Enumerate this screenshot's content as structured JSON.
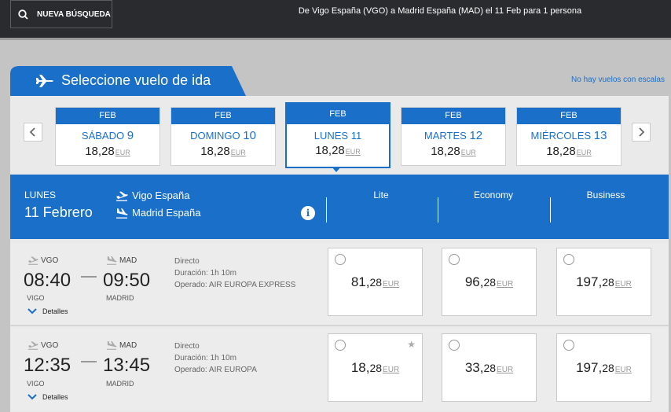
{
  "topbar": {
    "new_search": "NUEVA BÚSQUEDA",
    "route": "De Vigo España (VGO) a Madrid España (MAD) el 11 Feb para 1 persona"
  },
  "title": "Seleccione vuelo de ida",
  "no_connections": "No hay vuelos con escalas",
  "currency": "EUR",
  "days": [
    {
      "month": "FEB",
      "day": "SÁBADO",
      "num": "9",
      "int": "18,",
      "dec": "28"
    },
    {
      "month": "FEB",
      "day": "DOMINGO",
      "num": "10",
      "int": "18,",
      "dec": "28"
    },
    {
      "month": "FEB",
      "day": "LUNES",
      "num": "11",
      "int": "18,",
      "dec": "28"
    },
    {
      "month": "FEB",
      "day": "MARTES",
      "num": "12",
      "int": "18,",
      "dec": "28"
    },
    {
      "month": "FEB",
      "day": "MIÉRCOLES",
      "num": "13",
      "int": "18,",
      "dec": "28"
    }
  ],
  "header": {
    "weekday": "LUNES",
    "date": "11 Febrero",
    "origin": "Vigo España",
    "destination": "Madrid España",
    "fares": [
      "Lite",
      "Economy",
      "Business"
    ]
  },
  "flights": [
    {
      "from": "VGO",
      "to": "MAD",
      "dep": "08:40",
      "arr": "09:50",
      "from_city": "VIGO",
      "to_city": "MADRID",
      "type": "Directo",
      "duration": "Duración: 1h 10m",
      "operator": "Operado: AIR EUROPA EXPRESS",
      "details": "Detalles",
      "fares": [
        {
          "int": "81,",
          "dec": "28"
        },
        {
          "int": "96,",
          "dec": "28"
        },
        {
          "int": "197,",
          "dec": "28"
        }
      ]
    },
    {
      "from": "VGO",
      "to": "MAD",
      "dep": "12:35",
      "arr": "13:45",
      "from_city": "VIGO",
      "to_city": "MADRID",
      "type": "Directo",
      "duration": "Duración: 1h 10m",
      "operator": "Operado: AIR EUROPA",
      "details": "Detalles",
      "fares": [
        {
          "int": "18,",
          "dec": "28"
        },
        {
          "int": "33,",
          "dec": "28"
        },
        {
          "int": "197,",
          "dec": "28"
        }
      ]
    }
  ],
  "colors": {
    "brand_blue": "#1a6fc9",
    "topbar": "#2a2b2e"
  },
  "icons": [
    "search-icon",
    "plane-icon",
    "takeoff-icon",
    "landing-icon",
    "info-icon",
    "chevron-left-icon",
    "chevron-right-icon",
    "chevron-down-icon",
    "star-icon"
  ]
}
